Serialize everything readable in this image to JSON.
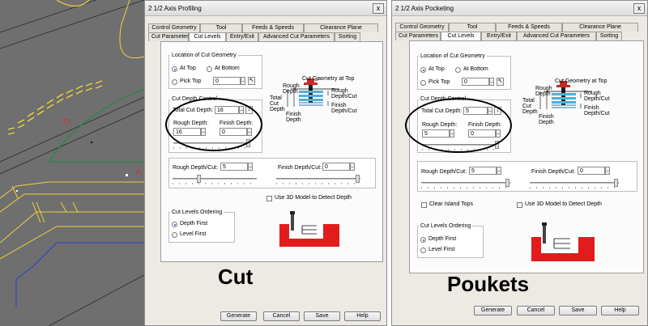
{
  "cut": {
    "title": "2 1/2 Axis Profiling",
    "close": "x",
    "tabs_back": [
      "Control Geometry",
      "Tool",
      "Feeds & Speeds",
      "Clearance Plane"
    ],
    "tabs_front": [
      "Cut Parameters",
      "Cut Levels",
      "Entry/Exit",
      "Advanced Cut Parameters",
      "Sorting"
    ],
    "location": {
      "title": "Location of Cut Geometry",
      "at_top": "At Top",
      "at_bottom": "At Bottom",
      "pick_top": "Pick Top",
      "pick_top_value": "0"
    },
    "depth": {
      "title": "Cut Depth Control",
      "total_label": "Total Cut Depth:",
      "total_value": "16",
      "rough_label": "Rough Depth:",
      "rough_value": "16",
      "finish_label": "Finish Depth:",
      "finish_value": "0"
    },
    "diagram": {
      "cut_geometry_at_top": "Cut Geometry at Top",
      "rough_depth": "Rough Depth",
      "rough_depth_cut": "Rough Depth/Cut",
      "total_cut_depth": "Total Cut Depth",
      "finish_depth": "Finish Depth",
      "finish_depth_cut": "Finish Depth/Cut"
    },
    "per_cut": {
      "rough_label": "Rough Depth/Cut:",
      "rough_value": "5",
      "finish_label": "Finish Depth/Cut:",
      "finish_value": "0"
    },
    "use_3d": "Use 3D Model to Detect Depth",
    "ordering": {
      "title": "Cut Levels Ordering",
      "depth_first": "Depth First",
      "level_first": "Level First"
    },
    "buttons": [
      "Generate",
      "Cancel",
      "Save",
      "Help"
    ]
  },
  "pocket": {
    "title": "2 1/2 Axis Pocketing",
    "close": "x",
    "tabs_back": [
      "Control Geometry",
      "Tool",
      "Feeds & Speeds",
      "Clearance Plane"
    ],
    "tabs_front": [
      "Cut Parameters",
      "Cut Levels",
      "Entry/Exit",
      "Advanced Cut Parameters",
      "Sorting"
    ],
    "location": {
      "title": "Location of Cut Geometry",
      "at_top": "At Top",
      "at_bottom": "At Bottom",
      "pick_top": "Pick Top",
      "pick_top_value": "0"
    },
    "depth": {
      "title": "Cut Depth Control",
      "total_label": "Total Cut Depth:",
      "total_value": "5",
      "rough_label": "Rough Depth:",
      "rough_value": "5",
      "finish_label": "Finish Depth:",
      "finish_value": "0"
    },
    "diagram": {
      "cut_geometry_at_top": "Cut Geometry at Top",
      "rough_depth": "Rough Depth",
      "rough_depth_cut": "Rough Depth/Cut",
      "total_cut_depth": "Total Cut Depth",
      "finish_depth": "Finish Depth",
      "finish_depth_cut": "Finish Depth/Cut"
    },
    "per_cut": {
      "rough_label": "Rough Depth/Cut:",
      "rough_value": "5",
      "finish_label": "Finish Depth/Cut:",
      "finish_value": "0"
    },
    "clear_island": "Clear Island Tops",
    "use_3d": "Use 3D Model to Detect Depth",
    "ordering": {
      "title": "Cut Levels Ordering",
      "depth_first": "Depth First",
      "level_first": "Level First"
    },
    "buttons": [
      "Generate",
      "Cancel",
      "Save",
      "Help"
    ]
  },
  "captions": {
    "cut": "Cut",
    "pockets": "Poukets"
  },
  "colors": {
    "cad_bg": "#6f6f6f",
    "toolpath_yellow": "#f0d23a",
    "toolpath_green": "#1f8a3a",
    "toolpath_blue": "#2b3fd0",
    "marker_red": "#d43030"
  }
}
